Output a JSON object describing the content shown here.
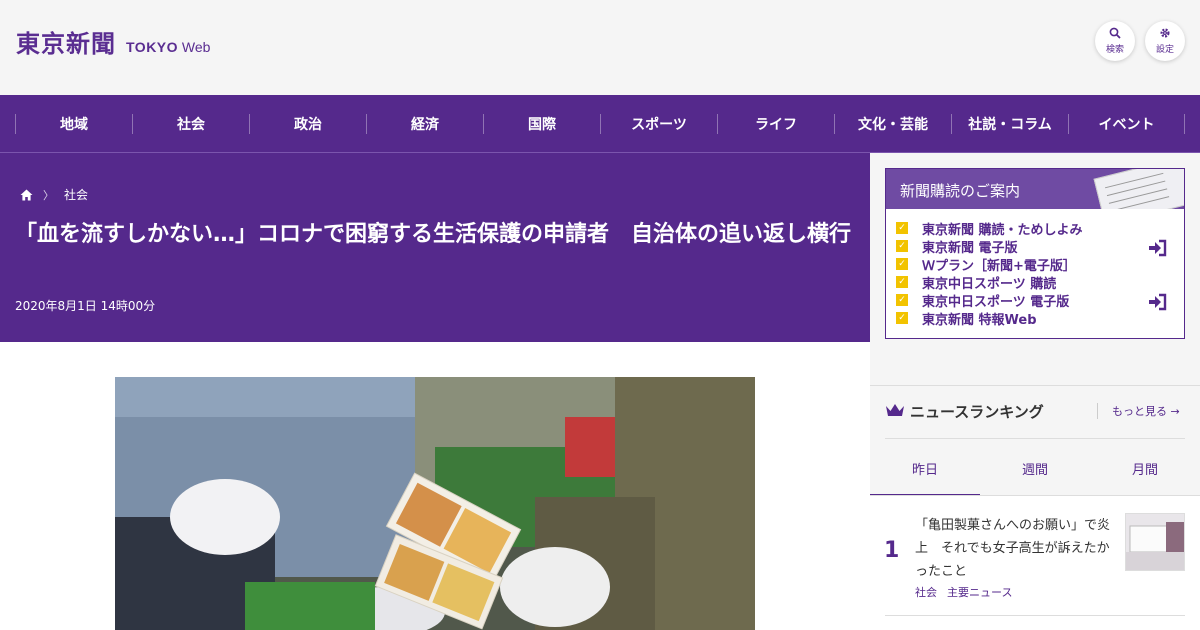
{
  "header": {
    "logo_kanji": "東京新聞",
    "logo_en_bold": "TOKYO",
    "logo_en_web": "Web",
    "search_label": "検索",
    "settings_label": "設定",
    "search_icon": "search-icon",
    "settings_icon": "gear-icon"
  },
  "nav": {
    "items": [
      "地域",
      "社会",
      "政治",
      "経済",
      "国際",
      "スポーツ",
      "ライフ",
      "文化・芸能",
      "社説・コラム",
      "イベント"
    ]
  },
  "article": {
    "breadcrumb_category": "社会",
    "title": "「血を流すしかない…」コロナで困窮する生活保護の申請者　自治体の追い返し横行",
    "date": "2020年8月1日 14時00分"
  },
  "subscription": {
    "heading": "新聞購読のご案内",
    "items": [
      {
        "label": "東京新聞 購読・ためしよみ",
        "has_arrow": true
      },
      {
        "label": "東京新聞 電子版",
        "has_arrow": false
      },
      {
        "label": "Ｗプラン［新聞+電子版］",
        "has_arrow": false
      },
      {
        "label": "東京中日スポーツ 購読",
        "has_arrow": false
      },
      {
        "label": "東京中日スポーツ 電子版",
        "has_arrow": true
      },
      {
        "label": "東京新聞 特報Web",
        "has_arrow": false
      }
    ]
  },
  "ranking": {
    "title": "ニュースランキング",
    "more_label": "もっと見る",
    "tabs": [
      "昨日",
      "週間",
      "月間"
    ],
    "active_tab": "昨日",
    "items": [
      {
        "rank": "1",
        "text": "「亀田製菓さんへのお願い」で炎上　それでも女子高生が訴えたかったこと",
        "tags": [
          "社会",
          "主要ニュース"
        ]
      }
    ]
  },
  "colors": {
    "brand_purple": "#55298c",
    "check_yellow": "#f2c300"
  }
}
